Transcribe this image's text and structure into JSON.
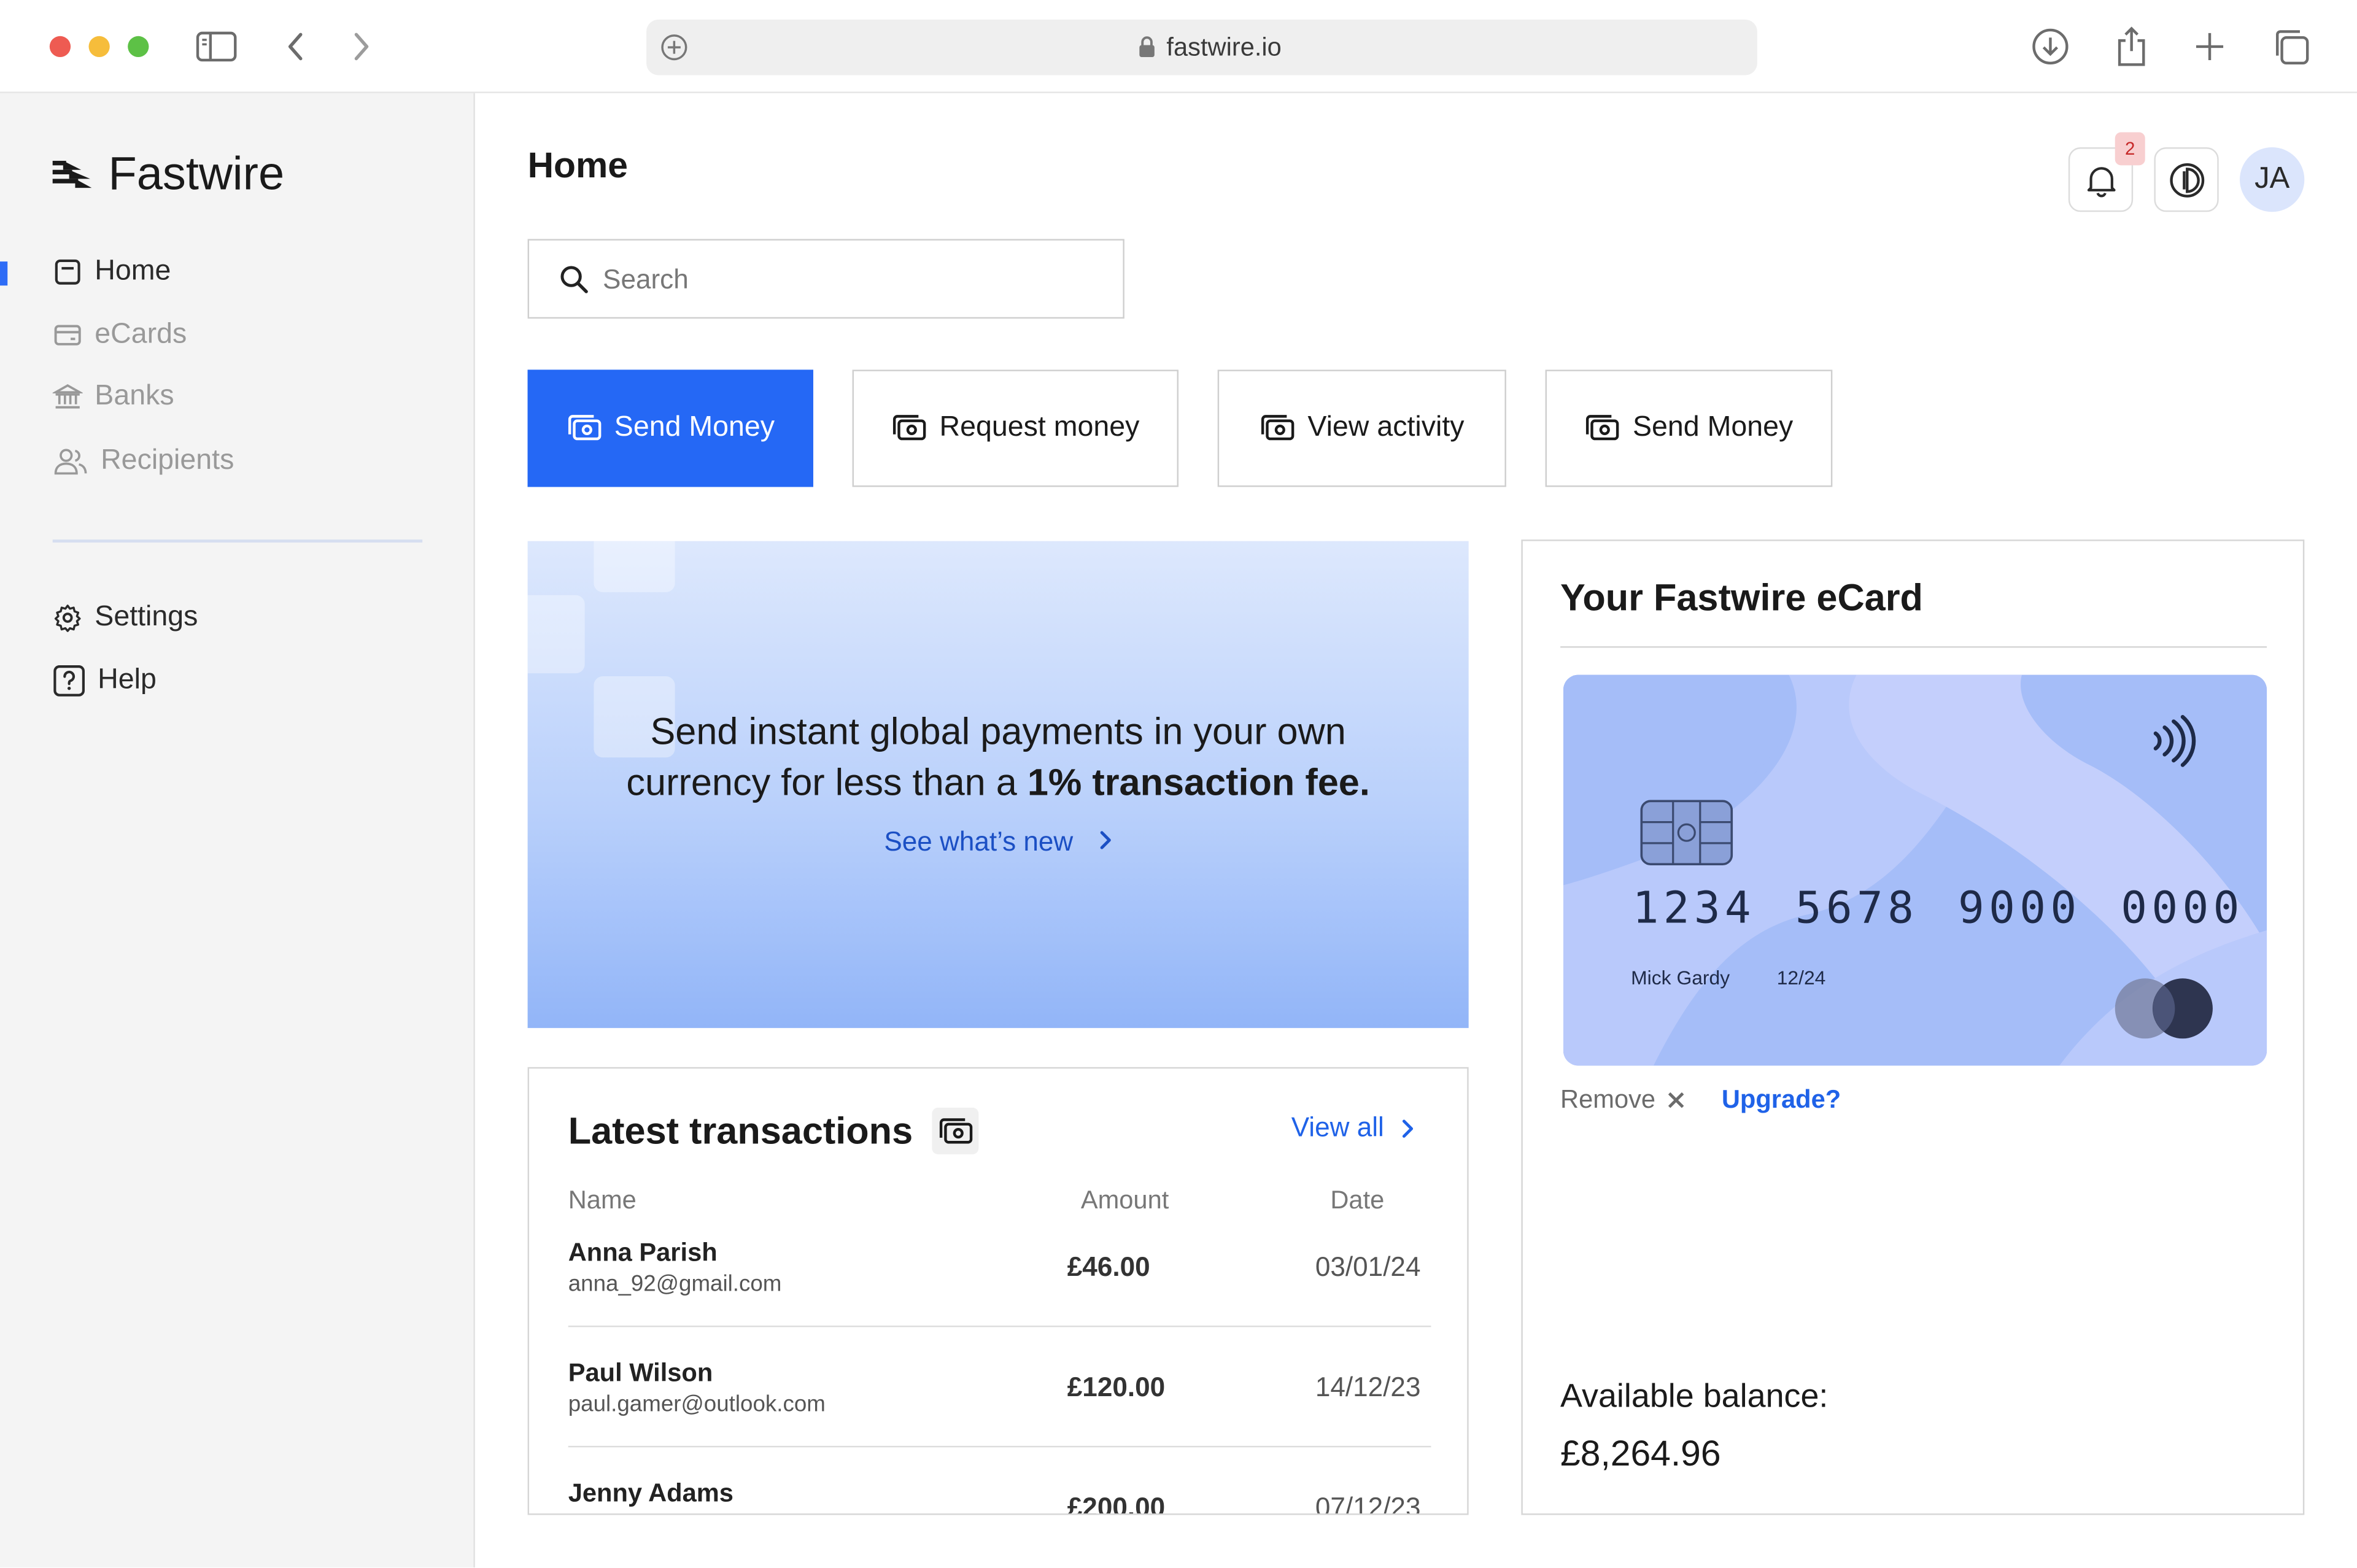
{
  "browser": {
    "url": "fastwire.io"
  },
  "sidebar": {
    "brand": "Fastwire",
    "items": [
      {
        "label": "Home",
        "icon": "home-icon",
        "active": true
      },
      {
        "label": "eCards",
        "icon": "card-icon",
        "active": false
      },
      {
        "label": "Banks",
        "icon": "bank-icon",
        "active": false
      },
      {
        "label": "Recipients",
        "icon": "users-icon",
        "active": false
      }
    ],
    "secondary": [
      {
        "label": "Settings",
        "icon": "gear-icon"
      },
      {
        "label": "Help",
        "icon": "help-icon"
      }
    ]
  },
  "header": {
    "title": "Home",
    "notification_count": "2",
    "avatar_initials": "JA"
  },
  "search": {
    "placeholder": "Search"
  },
  "actions": [
    {
      "label": "Send Money",
      "primary": true
    },
    {
      "label": "Request money",
      "primary": false
    },
    {
      "label": "View activity",
      "primary": false
    },
    {
      "label": "Send Money",
      "primary": false
    }
  ],
  "promo": {
    "line1": "Send instant global payments in your own",
    "line2_prefix": "currency for less than a ",
    "line2_bold": "1% transaction fee.",
    "link": "See what’s new"
  },
  "transactions": {
    "title": "Latest transactions",
    "view_all": "View all",
    "columns": {
      "name": "Name",
      "amount": "Amount",
      "date": "Date"
    },
    "rows": [
      {
        "name": "Anna Parish",
        "email": "anna_92@gmail.com",
        "amount": "£46.00",
        "date": "03/01/24"
      },
      {
        "name": "Paul Wilson",
        "email": "paul.gamer@outlook.com",
        "amount": "£120.00",
        "date": "14/12/23"
      },
      {
        "name": "Jenny Adams",
        "email": "",
        "amount": "£200.00",
        "date": "07/12/23"
      }
    ]
  },
  "ecard": {
    "title": "Your Fastwire eCard",
    "number": "1234 5678 9000 0000",
    "holder": "Mick Gardy",
    "expiry": "12/24",
    "remove_label": "Remove",
    "upgrade_label": "Upgrade?",
    "balance_label": "Available balance:",
    "balance_value": "£8,264.96"
  },
  "colors": {
    "accent": "#2568f5",
    "link": "#1f62e8",
    "sidebar_bg": "#f4f4f4",
    "card_bg": "#a5bdf8",
    "badge_bg": "#f8cfd0"
  }
}
